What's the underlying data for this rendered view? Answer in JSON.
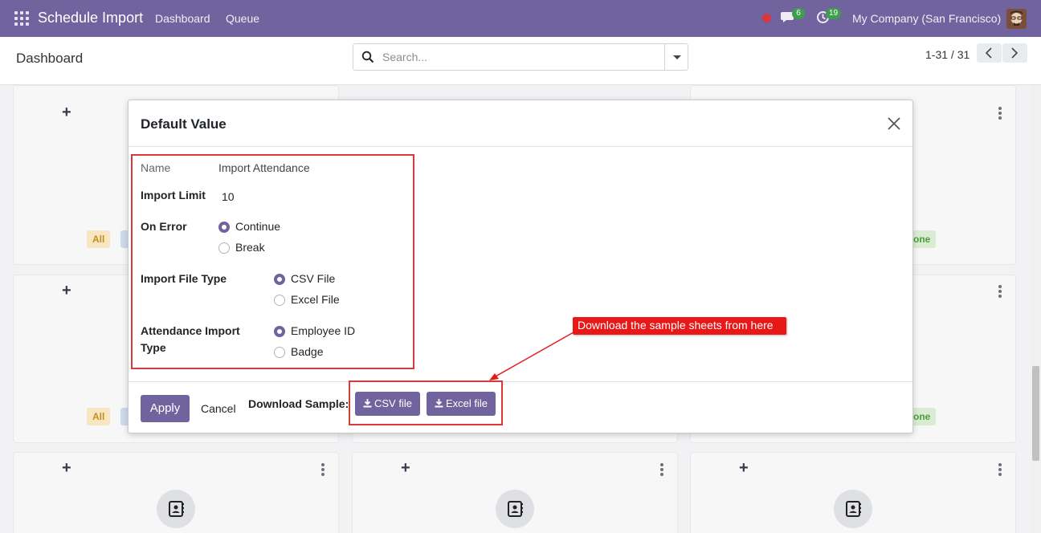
{
  "navbar": {
    "brand": "Schedule Import",
    "links": [
      "Dashboard",
      "Queue"
    ],
    "chat_count": "6",
    "activity_count": "19",
    "company": "My Company (San Francisco)"
  },
  "control_panel": {
    "title": "Dashboard",
    "search_placeholder": "Search...",
    "pager": "1-31 / 31"
  },
  "kanban": {
    "chip_all": "All",
    "chip_done_partial": "one"
  },
  "dialog": {
    "title": "Default Value",
    "fields": {
      "name_label": "Name",
      "name_value": "Import Attendance",
      "limit_label": "Import Limit",
      "limit_value": "10",
      "on_error_label": "On Error",
      "on_error_options": [
        "Continue",
        "Break"
      ],
      "on_error_selected": "Continue",
      "file_type_label": "Import File Type",
      "file_type_options": [
        "CSV File",
        "Excel File"
      ],
      "file_type_selected": "CSV File",
      "attendance_type_label_line1": "Attendance Import",
      "attendance_type_label_line2": "Type",
      "attendance_type_options": [
        "Employee ID",
        "Badge"
      ],
      "attendance_type_selected": "Employee ID"
    },
    "footer": {
      "apply": "Apply",
      "cancel": "Cancel",
      "download_label": "Download Sample:",
      "csv_button": "CSV file",
      "excel_button": "Excel file"
    }
  },
  "annotation": {
    "callout": "Download the sample sheets from here",
    "color": "#e81818"
  },
  "colors": {
    "brand": "#71639e",
    "highlight": "#d63a3a"
  }
}
